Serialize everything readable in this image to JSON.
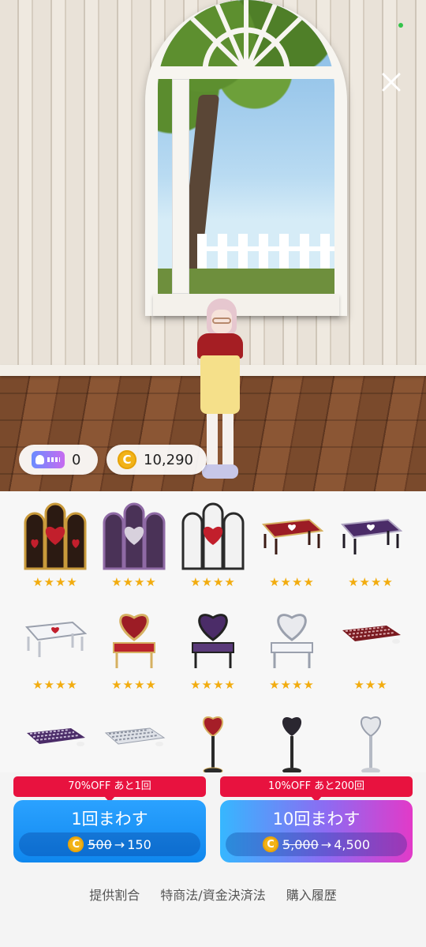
{
  "wallet": {
    "tickets": "0",
    "coins": "10,290"
  },
  "prizes": [
    {
      "icon": "gold-heart-screen-icon",
      "stars": "★★★★"
    },
    {
      "icon": "purple-heart-screen-icon",
      "stars": "★★★★"
    },
    {
      "icon": "silver-heart-screen-icon",
      "stars": "★★★★"
    },
    {
      "icon": "red-heart-table-icon",
      "stars": "★★★★"
    },
    {
      "icon": "purple-heart-table-icon",
      "stars": "★★★★"
    },
    {
      "icon": "white-heart-table-icon",
      "stars": "★★★★"
    },
    {
      "icon": "red-heart-chair-icon",
      "stars": "★★★★"
    },
    {
      "icon": "purple-heart-chair-icon",
      "stars": "★★★★"
    },
    {
      "icon": "white-heart-chair-icon",
      "stars": "★★★★"
    },
    {
      "icon": "red-keyboard-icon",
      "stars": "★★★"
    },
    {
      "icon": "purple-keyboard-icon",
      "stars": "★★★"
    },
    {
      "icon": "white-keyboard-icon",
      "stars": "★★★"
    },
    {
      "icon": "red-heart-lamp-icon",
      "stars": "★★★"
    },
    {
      "icon": "black-heart-lamp-icon",
      "stars": "★★★"
    },
    {
      "icon": "silver-heart-lamp-icon",
      "stars": "★★★"
    }
  ],
  "spin1": {
    "banner": "70%OFF あと1回",
    "label": "1回まわす",
    "coin_symbol": "C",
    "old_price": "500",
    "arrow": "→",
    "new_price": "150"
  },
  "spin10": {
    "banner": "10%OFF あと200回",
    "label": "10回まわす",
    "coin_symbol": "C",
    "old_price": "5,000",
    "arrow": "→",
    "new_price": "4,500"
  },
  "footer": {
    "rates": "提供割合",
    "legal": "特商法/資金決済法",
    "history": "購入履歴"
  },
  "colors": {
    "banner": "#e8123f",
    "spin1": "#1a93f7",
    "spin10_from": "#36b7ff",
    "spin10_to": "#e23ac8",
    "star": "#f2ac0f",
    "coin": "#f2b318"
  }
}
